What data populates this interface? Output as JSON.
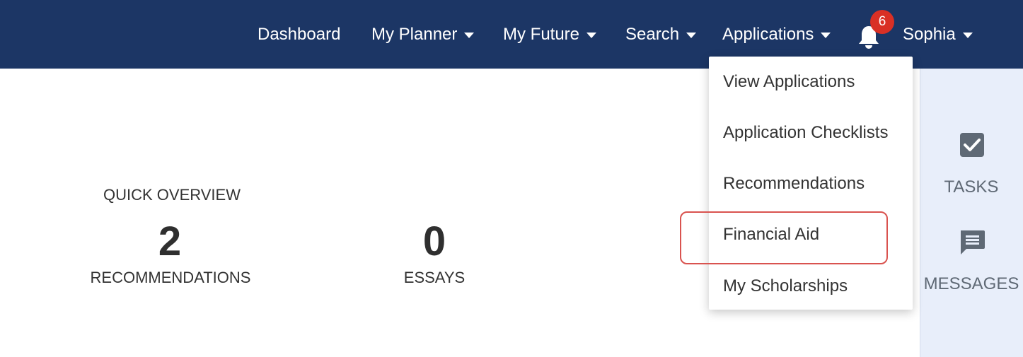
{
  "nav": {
    "dashboard": "Dashboard",
    "my_planner": "My Planner",
    "my_future": "My Future",
    "search": "Search",
    "applications": "Applications",
    "user": "Sophia",
    "notification_count": "6"
  },
  "applications_menu": {
    "items": [
      "View Applications",
      "Application Checklists",
      "Recommendations",
      "Financial Aid",
      "My Scholarships"
    ]
  },
  "overview": {
    "title": "QUICK OVERVIEW",
    "recommendations_count": "2",
    "recommendations_label": "RECOMMENDATIONS",
    "essays_count": "0",
    "essays_label": "ESSAYS"
  },
  "sidebar": {
    "tasks_label": "TASKS",
    "messages_label": "MESSAGES"
  },
  "colors": {
    "navbar": "#1c3665",
    "badge": "#d93025",
    "highlight": "#d9534f",
    "side_panel": "#e8eefa"
  },
  "icons": [
    "caret-down-icon",
    "bell-icon",
    "checkbox-icon",
    "message-icon"
  ]
}
